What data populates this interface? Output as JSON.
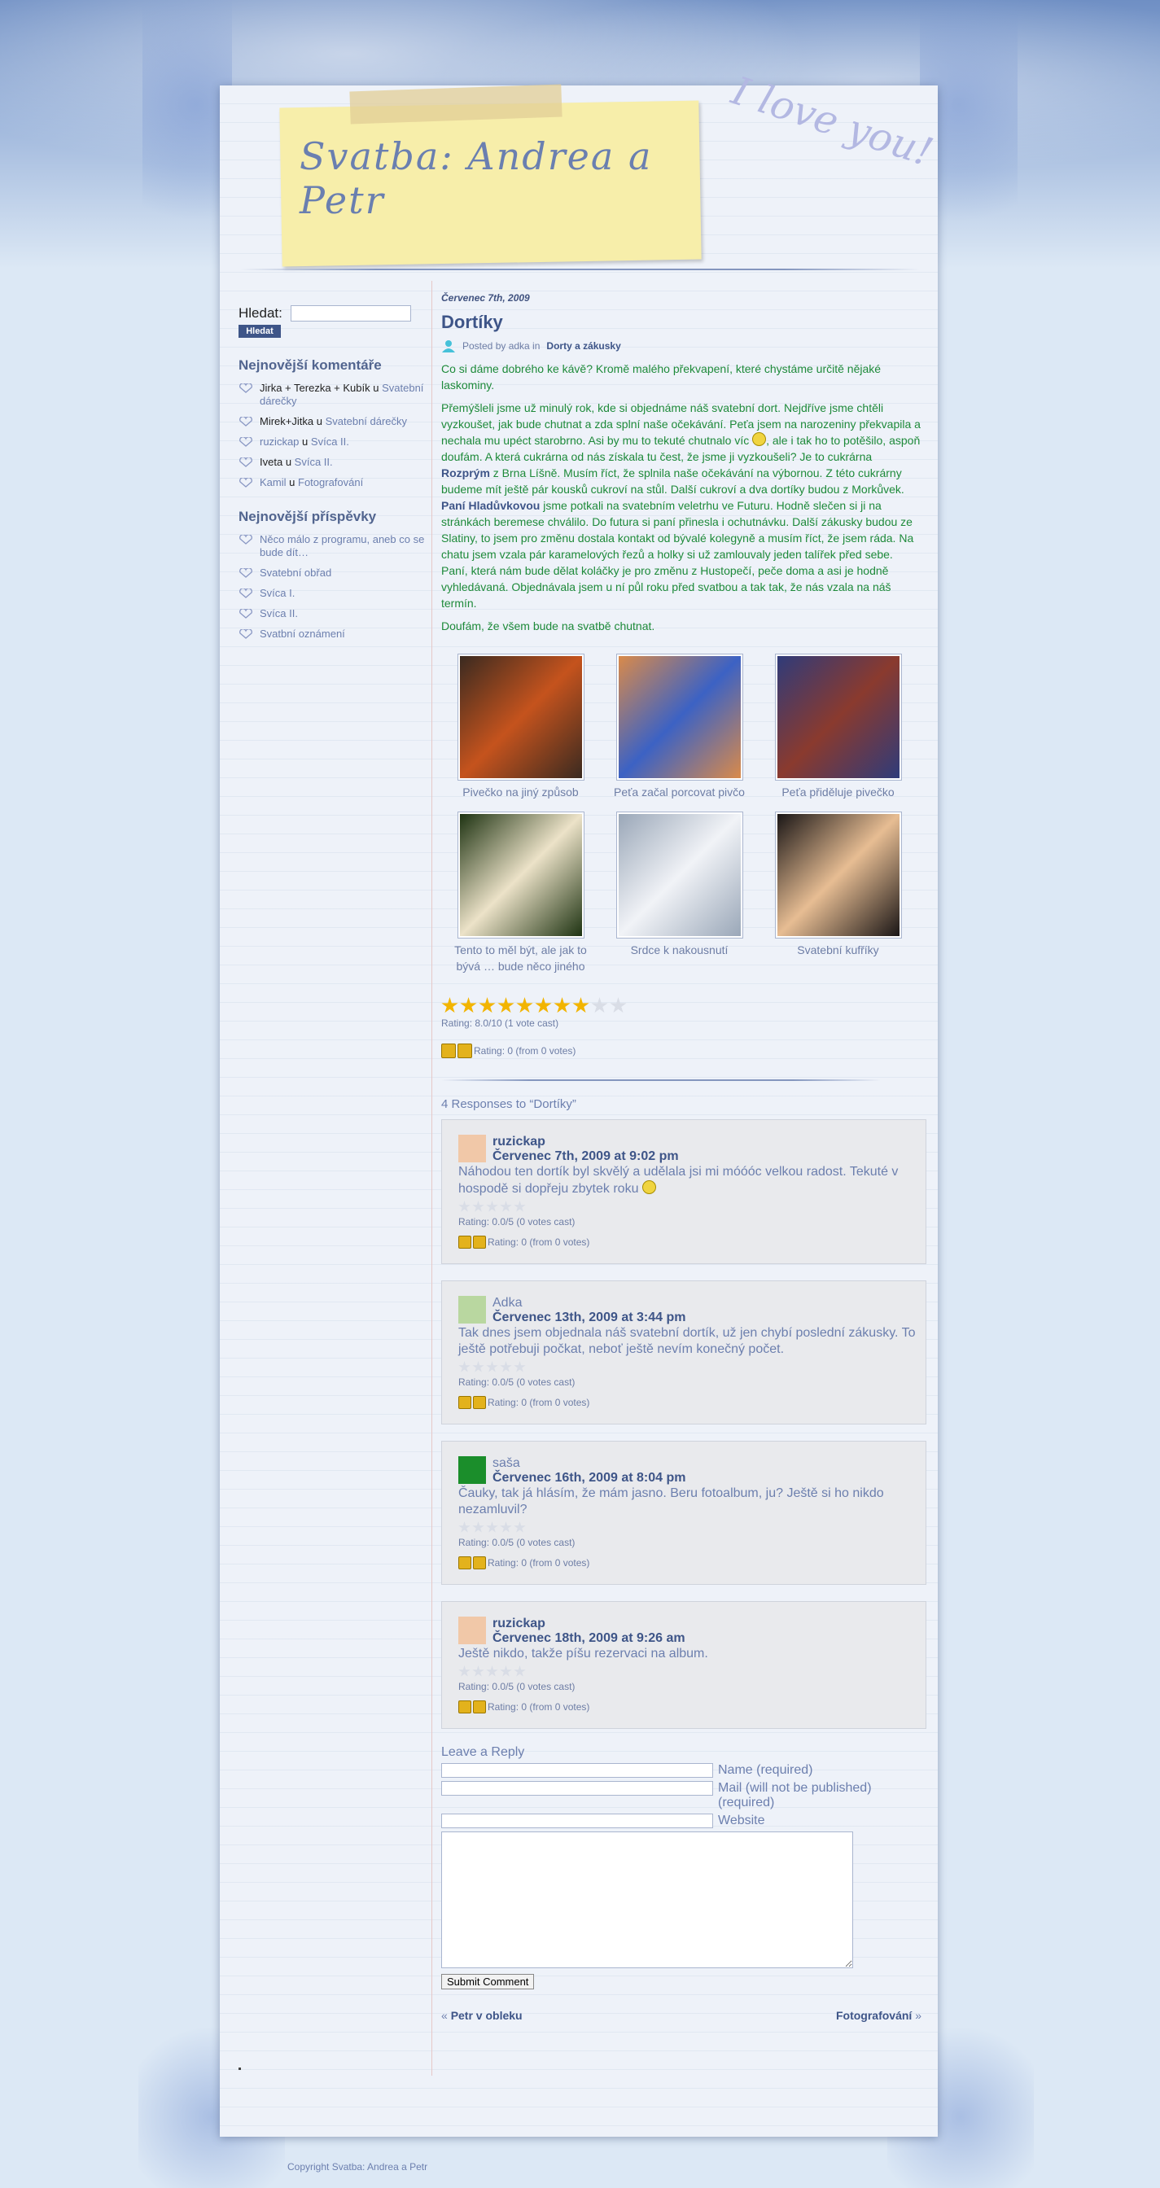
{
  "site": {
    "title": "Svatba: Andrea a Petr",
    "love_text": "I love you!"
  },
  "sidebar": {
    "search_label": "Hledat:",
    "search_value": "",
    "search_button": "Hledat",
    "comments_heading": "Nejnovější komentáře",
    "comments": [
      {
        "author": "Jirka + Terezka + Kubík",
        "sep": "u",
        "post": "Svatební dárečky"
      },
      {
        "author": "Mirek+Jitka",
        "sep": "u",
        "post": "Svatební dárečky"
      },
      {
        "author": "ruzickap",
        "sep": "u",
        "post": "Svíca II."
      },
      {
        "author": "Iveta",
        "sep": "u",
        "post": "Svíca II."
      },
      {
        "author": "Kamil",
        "sep": "u",
        "post": "Fotografování"
      }
    ],
    "posts_heading": "Nejnovější příspěvky",
    "posts": [
      "Něco málo z programu, aneb co se bude dít…",
      "Svatební obřad",
      "Svíca I.",
      "Svíca II.",
      "Svatbní oznámení"
    ]
  },
  "post": {
    "date": "Červenec 7th, 2009",
    "title": "Dortíky",
    "meta_prefix": "Posted by adka in",
    "meta_category": "Dorty a zákusky",
    "p1": "Co si dáme dobrého ke kávě? Kromě malého překvapení, které chystáme určitě nějaké laskominy.",
    "p2_a": "Přemýšleli jsme už minulý rok, kde si objednáme náš svatební dort. Nejdříve jsme chtěli vyzkoušet, jak bude chutnat a zda splní naše očekávání. Peťa jsem na narozeniny překvapila a nechala mu upéct starobrno. Asi by mu to tekuté chutnalo víc ",
    "p2_b": ", ale i tak ho to potěšilo, aspoň doufám. A která cukrárna od nás získala tu čest, že jsme ji vyzkoušeli? Je to cukrárna ",
    "p2_shop": "Rozprým",
    "p2_c": " z Brna Líšně. Musím říct, že splnila naše očekávání na výbornou. Z této cukrárny budeme mít ještě pár kousků cukroví na stůl. Další cukroví a dva dortíky budou z Morkůvek. ",
    "p2_lady": "Paní Hladůvkovou",
    "p2_d": " jsme potkali na svatebním veletrhu ve Futuru. Hodně slečen si ji na stránkách beremese chválilo. Do futura si paní přinesla i ochutnávku. Další zákusky budou ze Slatiny, to jsem pro změnu dostala kontakt od bývalé kolegyně a musím říct, že jsem ráda. Na chatu jsem vzala pár karamelových řezů a holky si už zamlouvaly jeden talířek před sebe. Paní, která nám bude dělat koláčky je pro změnu z Hustopečí, peče doma a asi je hodně vyhledávaná. Objednávala jsem u ní půl roku před svatbou a tak tak, že nás vzala na náš termín.",
    "p3": "Doufám, že všem bude na svatbě chutnat.",
    "gallery": [
      {
        "caption": "Pivečko na jiný způsob",
        "color_a": "#c5531d",
        "color_b": "#3a2a20"
      },
      {
        "caption": "Peťa začal porcovat pivčo",
        "color_a": "#3c62c4",
        "color_b": "#d98a4a"
      },
      {
        "caption": "Peťa přiděluje pivečko",
        "color_a": "#8a3a2e",
        "color_b": "#2f3b7a"
      },
      {
        "caption": "Tento to měl být, ale jak to bývá … bude něco jiného",
        "color_a": "#ece2c8",
        "color_b": "#1e3312"
      },
      {
        "caption": "Srdce k nakousnutí",
        "color_a": "#f1f3f7",
        "color_b": "#9aa7b8"
      },
      {
        "caption": "Svatební kufříky",
        "color_a": "#e7bd93",
        "color_b": "#1a1616"
      }
    ],
    "stars_on": 8,
    "stars_total": 10,
    "rating_text": "Rating: 8.0/10 (1 vote cast)",
    "thumbs_text": "Rating: 0 (from 0 votes)"
  },
  "comments": {
    "heading": "4 Responses to “Dortíky”",
    "items": [
      {
        "author": "ruzickap",
        "date": "Červenec 7th, 2009 at 9:02 pm",
        "text": "Náhodou ten dortík byl skvělý a udělala jsi mi móóóc velkou radost. Tekuté v hospodě si dopřeju zbytek roku",
        "smiley": true,
        "rating": "Rating: 0.0/5 (0 votes cast)",
        "thumbs": "Rating: 0 (from 0 votes)",
        "avatar": "#f1c8a8",
        "linked": true
      },
      {
        "author": "Adka",
        "date": "Červenec 13th, 2009 at 3:44 pm",
        "text": "Tak dnes jsem objednala náš svatební dortík, už jen chybí poslední zákusky. To ještě potřebuji počkat, neboť ještě nevím konečný počet.",
        "smiley": false,
        "rating": "Rating: 0.0/5 (0 votes cast)",
        "thumbs": "Rating: 0 (from 0 votes)",
        "avatar": "#b9d7a0",
        "linked": false
      },
      {
        "author": "saša",
        "date": "Červenec 16th, 2009 at 8:04 pm",
        "text": "Čauky, tak já hlásím, že mám jasno. Beru fotoalbum, ju? Ještě si ho nikdo nezamluvil?",
        "smiley": false,
        "rating": "Rating: 0.0/5 (0 votes cast)",
        "thumbs": "Rating: 0 (from 0 votes)",
        "avatar": "#1b8e2b",
        "linked": false
      },
      {
        "author": "ruzickap",
        "date": "Červenec 18th, 2009 at 9:26 am",
        "text": "Ještě nikdo, takže píšu rezervaci na album.",
        "smiley": false,
        "rating": "Rating: 0.0/5 (0 votes cast)",
        "thumbs": "Rating: 0 (from 0 votes)",
        "avatar": "#f1c8a8",
        "linked": true
      }
    ]
  },
  "form": {
    "title": "Leave a Reply",
    "name_label": "Name (required)",
    "mail_label": "Mail (will not be published) (required)",
    "website_label": "Website",
    "submit": "Submit Comment"
  },
  "nav": {
    "prev": "Petr v obleku",
    "next": "Fotografování"
  },
  "footer": {
    "copyright": "Copyright Svatba: Andrea a Petr"
  }
}
